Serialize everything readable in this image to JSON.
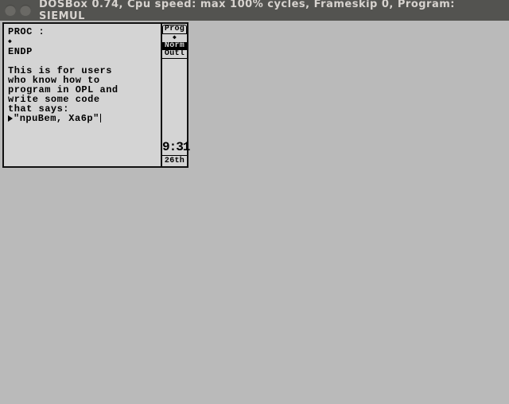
{
  "titlebar": {
    "text": "DOSBox 0.74, Cpu speed: max 100% cycles, Frameskip  0, Program:   SIEMUL"
  },
  "editor": {
    "line1": "PROC :",
    "line2": "◆",
    "line3": "ENDP",
    "line4": "This is for users",
    "line5": "who know how to",
    "line6": "program in OPL and",
    "line7": "write some code",
    "line8": "that says:",
    "input_value": "\"npuBem, Xa6p\""
  },
  "side": {
    "tab": "Prog",
    "diamond": "◆",
    "mode_selected": "Norm",
    "mode_other": "Outl",
    "clock": "9:31",
    "date": "26th"
  }
}
